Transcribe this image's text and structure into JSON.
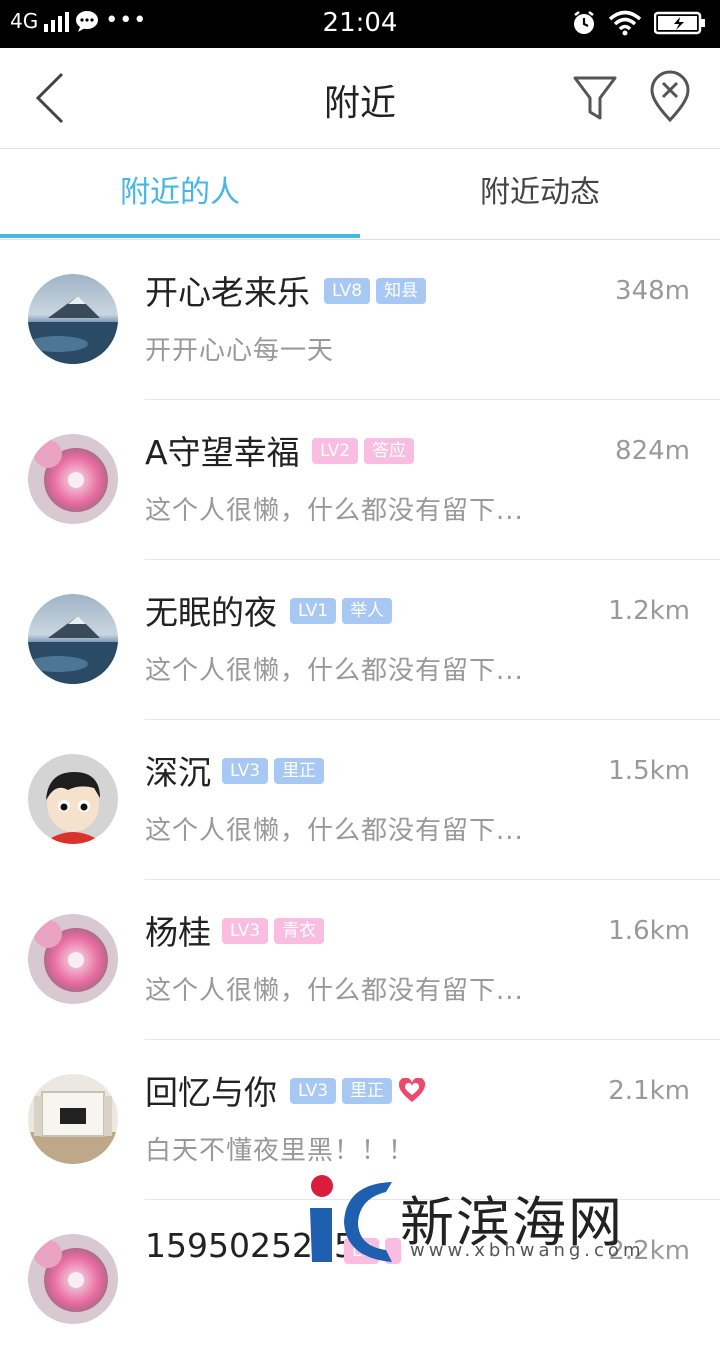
{
  "status_bar": {
    "network": "4G",
    "time": "21:04"
  },
  "nav": {
    "title": "附近"
  },
  "tabs": [
    {
      "label": "附近的人",
      "active": true
    },
    {
      "label": "附近动态",
      "active": false
    }
  ],
  "people": [
    {
      "name": "开心老来乐",
      "level": "LV8",
      "title": "知县",
      "badge_color": "blue",
      "distance": "348m",
      "signature": "开开心心每一天",
      "avatar": "seascape"
    },
    {
      "name": "A守望幸福",
      "level": "LV2",
      "title": "答应",
      "badge_color": "pink",
      "distance": "824m",
      "signature": "这个人很懒，什么都没有留下...",
      "avatar": "pink-flower"
    },
    {
      "name": "无眠的夜",
      "level": "LV1",
      "title": "举人",
      "badge_color": "blue",
      "distance": "1.2km",
      "signature": "这个人很懒，什么都没有留下...",
      "avatar": "seascape"
    },
    {
      "name": "深沉",
      "level": "LV3",
      "title": "里正",
      "badge_color": "blue",
      "distance": "1.5km",
      "signature": "这个人很懒，什么都没有留下...",
      "avatar": "cartoon-boy"
    },
    {
      "name": "杨桂",
      "level": "LV3",
      "title": "青衣",
      "badge_color": "pink",
      "distance": "1.6km",
      "signature": "这个人很懒，什么都没有留下...",
      "avatar": "pink-flower"
    },
    {
      "name": "回忆与你",
      "level": "LV3",
      "title": "里正",
      "badge_color": "blue",
      "distance": "2.1km",
      "signature": "白天不懂夜里黑！！！",
      "avatar": "room",
      "heart": true
    },
    {
      "name": "1595025285",
      "level": "LV",
      "title": "",
      "badge_color": "pink",
      "distance": "2.2km",
      "signature": "",
      "avatar": "pink-flower"
    }
  ],
  "watermark": {
    "text": "新滨海网",
    "url": "www.xbhwang.com"
  },
  "colors": {
    "accent": "#45b6e8",
    "badge_blue": "#a6c8f2",
    "badge_pink": "#f8bde0"
  }
}
